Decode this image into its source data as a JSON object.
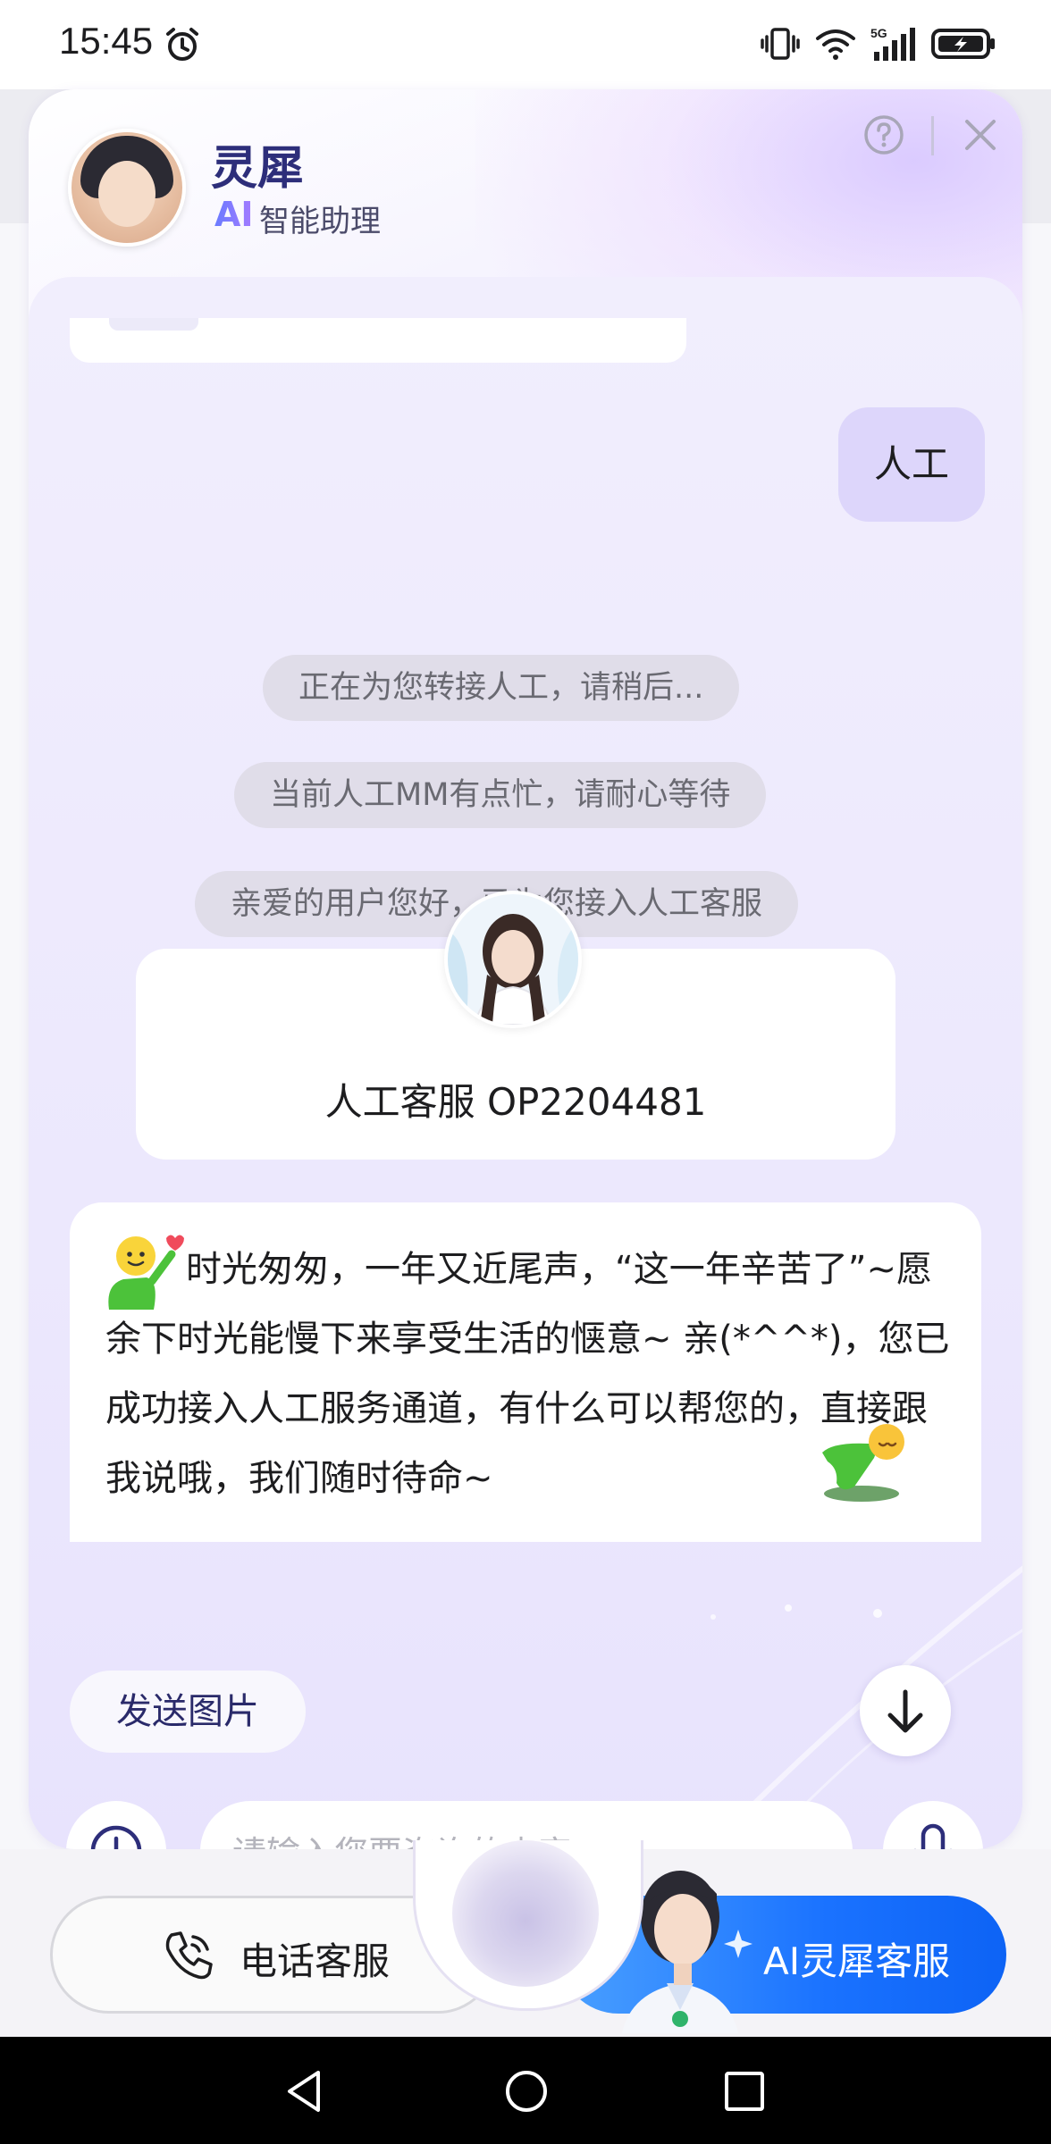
{
  "status_bar": {
    "time": "15:45",
    "icons": [
      "alarm-icon",
      "vibrate-icon",
      "wifi-icon",
      "signal-5g-icon",
      "battery-charging-icon"
    ],
    "network_label": "5G"
  },
  "header": {
    "title": "灵犀",
    "subtitle_prefix": "AI",
    "subtitle": "智能助理"
  },
  "chat": {
    "user_message": "人工",
    "system_messages": [
      "正在为您转接人工，请稍后...",
      "当前人工MM有点忙，请耐心等待",
      "亲爱的用户您好，已为您接入人工客服"
    ],
    "agent_name": "人工客服 OP2204481",
    "agent_message": "时光匆匆，一年又近尾声，“这一年辛苦了”~愿余下时光能慢下来享受生活的惬意~ 亲(*^^*)，您已成功接入人工服务通道，有什么可以帮您的，直接跟我说哦，我们随时待命~"
  },
  "actions": {
    "send_image": "发送图片"
  },
  "input": {
    "placeholder": "请输入您要咨询的内容"
  },
  "bottom": {
    "phone_service": "电话客服",
    "ai_service": "AI灵犀客服"
  },
  "colors": {
    "accent_blue": "#1a72ff",
    "title_navy": "#2d2e7a",
    "user_bubble": "#ddd6fb"
  }
}
